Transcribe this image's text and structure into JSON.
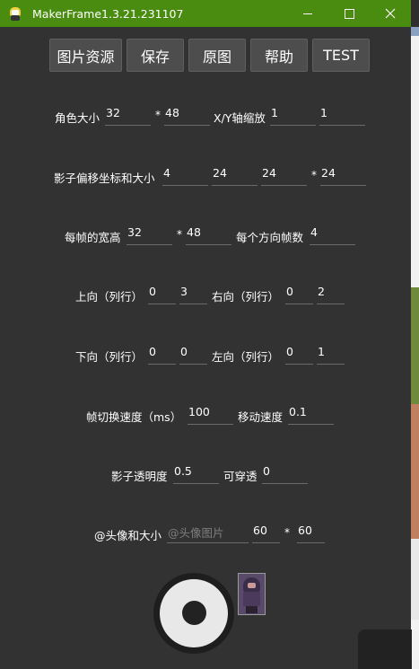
{
  "window": {
    "title": "MakerFrame1.3.21.231107"
  },
  "toolbar": {
    "buttons": [
      "图片资源",
      "保存",
      "原图",
      "帮助",
      "TEST"
    ]
  },
  "role_size": {
    "label": "角色大小",
    "w": "32",
    "h": "48"
  },
  "xy_scale": {
    "label": "X/Y轴缩放",
    "x": "1",
    "y": "1"
  },
  "shadow": {
    "label": "影子偏移坐标和大小",
    "x": "4",
    "y": "24",
    "w": "24",
    "h": "24"
  },
  "frame_size": {
    "label": "每帧的宽高",
    "w": "32",
    "h": "48"
  },
  "frames_per_dir": {
    "label": "每个方向帧数",
    "value": "4"
  },
  "dir_up": {
    "label": "上向（列行）",
    "col": "0",
    "row": "3"
  },
  "dir_right": {
    "label": "右向（列行）",
    "col": "0",
    "row": "2"
  },
  "dir_down": {
    "label": "下向（列行）",
    "col": "0",
    "row": "0"
  },
  "dir_left": {
    "label": "左向（列行）",
    "col": "0",
    "row": "1"
  },
  "frame_interval": {
    "label": "帧切换速度（ms）",
    "value": "100"
  },
  "move_speed": {
    "label": "移动速度",
    "value": "0.1"
  },
  "shadow_opacity": {
    "label": "影子透明度",
    "value": "0.5"
  },
  "passable": {
    "label": "可穿透",
    "value": "0"
  },
  "avatar": {
    "label": "@头像和大小",
    "placeholder": "@头像图片",
    "w": "60",
    "h": "60"
  },
  "star": "*"
}
